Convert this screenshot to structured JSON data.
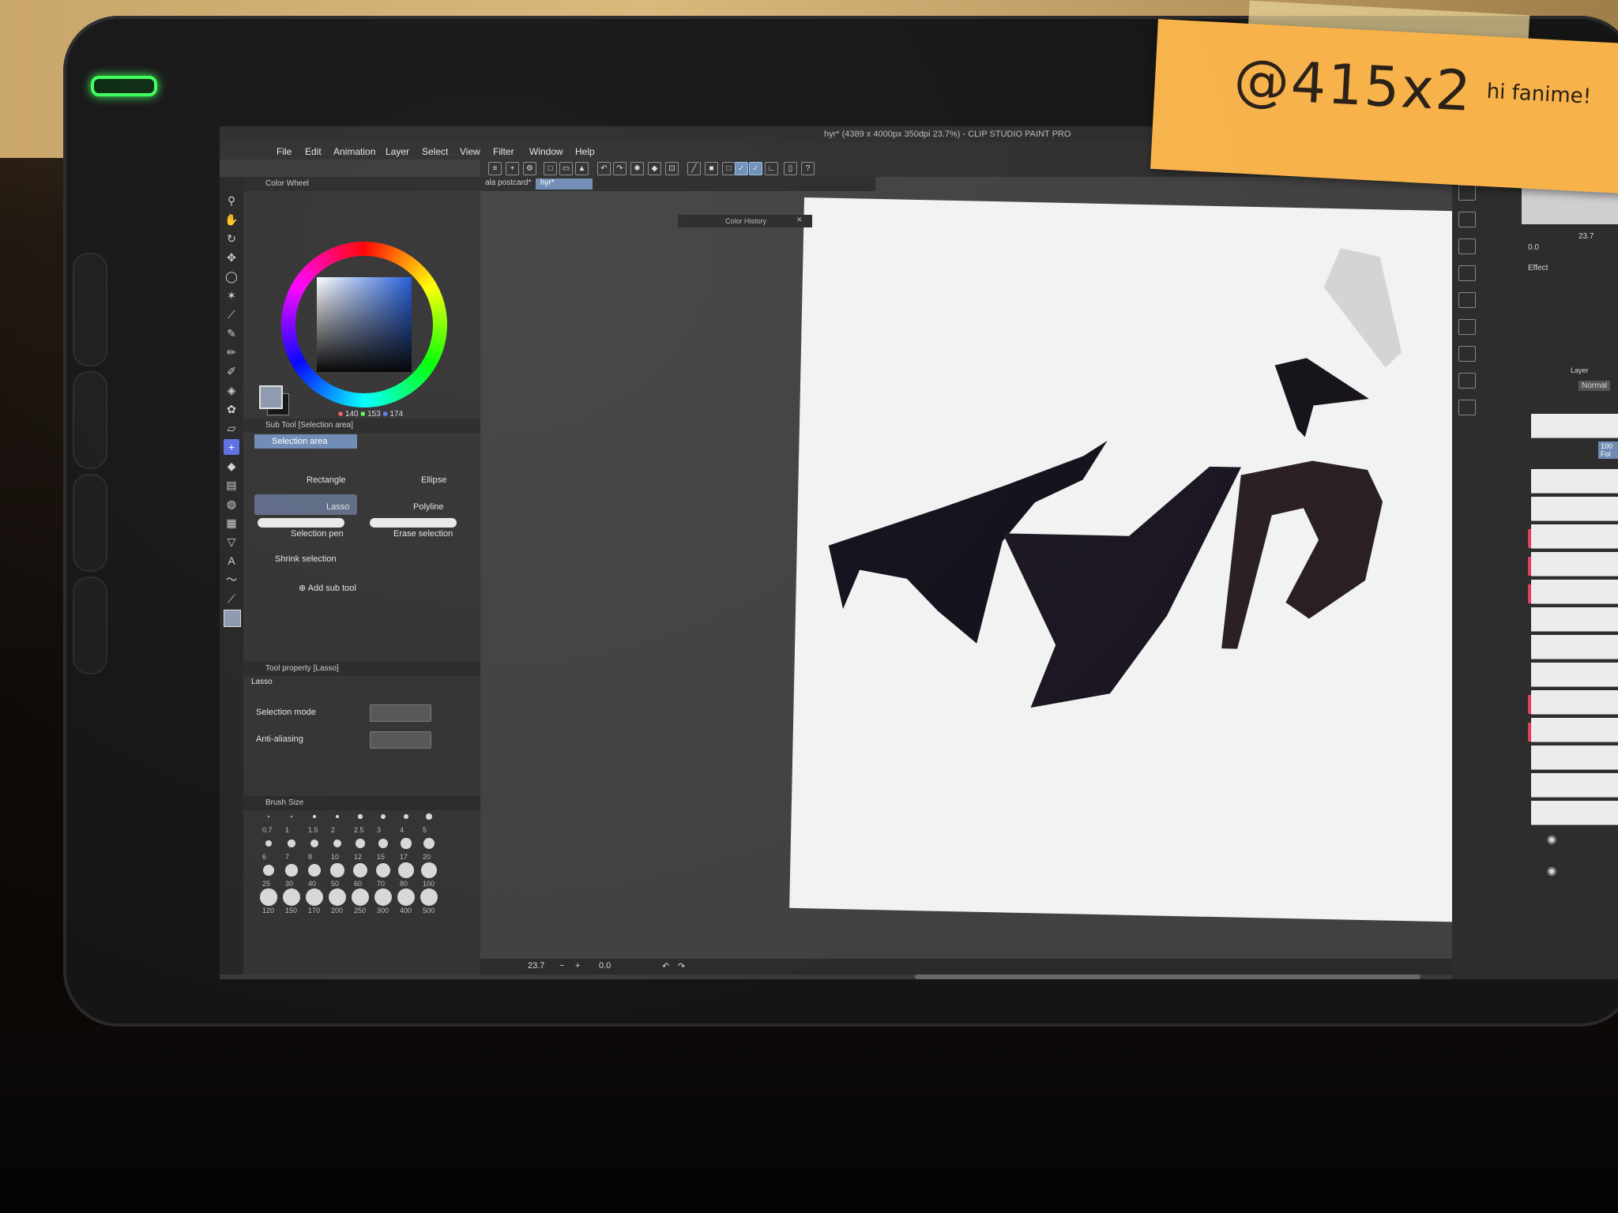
{
  "app": {
    "title": "hyr* (4389 x 4000px 350dpi 23.7%) - CLIP STUDIO PAINT PRO"
  },
  "menu": [
    "File",
    "Edit",
    "Animation",
    "Layer",
    "Select",
    "View",
    "Filter",
    "Window",
    "Help"
  ],
  "document_tabs": [
    {
      "label": "ala postcard*",
      "active": false
    },
    {
      "label": "hyr*",
      "active": true
    }
  ],
  "color_wheel": {
    "title": "Color Wheel",
    "r": "140",
    "g": "153",
    "b": "174",
    "main_color": "#8c99ae",
    "sub_color": "#111111"
  },
  "color_history": {
    "title": "Color History"
  },
  "sub_tool": {
    "title": "Sub Tool [Selection area]",
    "group_tab": "Selection area",
    "items": [
      {
        "label": "Rectangle",
        "selected": false
      },
      {
        "label": "Ellipse",
        "selected": false
      },
      {
        "label": "Lasso",
        "selected": true
      },
      {
        "label": "Polyline",
        "selected": false
      },
      {
        "label": "Selection pen",
        "selected": false
      },
      {
        "label": "Erase selection",
        "selected": false
      },
      {
        "label": "Shrink selection",
        "selected": false
      }
    ],
    "add_label": "Add sub tool"
  },
  "tool_property": {
    "title": "Tool property [Lasso]",
    "tool_name": "Lasso",
    "rows": [
      {
        "label": "Selection mode"
      },
      {
        "label": "Anti-aliasing"
      }
    ]
  },
  "brush_size": {
    "title": "Brush Size",
    "sizes": [
      "0.7",
      "1",
      "1.5",
      "2",
      "2.5",
      "3",
      "4",
      "5",
      "6",
      "7",
      "8",
      "10",
      "12",
      "15",
      "17",
      "20",
      "25",
      "30",
      "40",
      "50",
      "60",
      "70",
      "80",
      "100",
      "120",
      "150",
      "170",
      "200",
      "250",
      "300",
      "400",
      "500"
    ]
  },
  "statusbar": {
    "zoom": "23.7",
    "rotation": "0.0"
  },
  "right_panel": {
    "zoom": "23.7",
    "angle": "0.0",
    "effect_label": "Effect",
    "layer_title": "Layer",
    "blend_mode": "Normal",
    "folder_label": "100 Fol"
  },
  "sticky_note": {
    "main_text": "@415x2",
    "small_text": "hi fanime!"
  },
  "colors": {
    "accent": "#6f8bb4",
    "active_tool": "#5b6fe0",
    "led": "#3cff5a",
    "sticky": "#f7b24a"
  }
}
